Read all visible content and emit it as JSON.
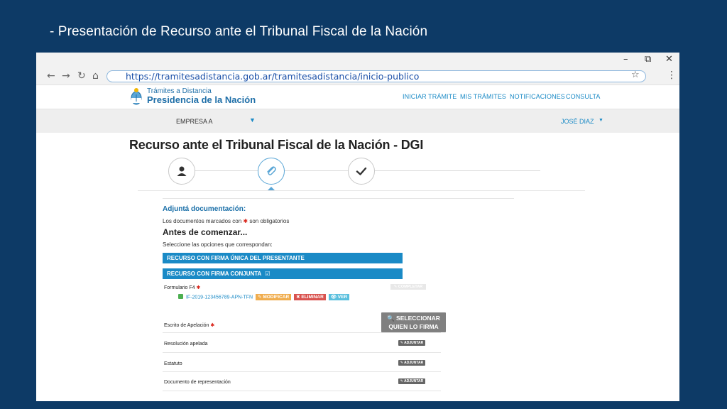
{
  "slide": {
    "title": "- Presentación de Recurso ante el Tribunal Fiscal de la Nación"
  },
  "window": {
    "minimize": "–",
    "restore": "⧉",
    "close": "✕"
  },
  "browser": {
    "back": "←",
    "forward": "→",
    "reload": "↻",
    "home": "⌂",
    "url": "https://tramitesadistancia.gob.ar/tramitesadistancia/inicio-publico",
    "star": "☆",
    "menu": "⋮"
  },
  "site": {
    "logo_line1": "Trámites a Distancia",
    "logo_line2": "Presidencia de la Nación",
    "nav": [
      "INICIAR TRÁMITE",
      "MIS TRÁMITES",
      "NOTIFICACIONES",
      "CONSULTA"
    ]
  },
  "userbar": {
    "empresa": "EMPRESA A",
    "empresa_caret": "▼",
    "user": "JOSÉ DIAZ",
    "user_caret": "▼"
  },
  "page": {
    "title": "Recurso ante el Tribunal Fiscal de la Nación - DGI"
  },
  "form": {
    "section_title": "Adjuntá documentación:",
    "note_before": "Los documentos marcados con",
    "req_mark": "✱",
    "note_after": "son obligatorios",
    "before_title": "Antes de comenzar...",
    "select_hint": "Seleccione las opciones que correspondan:",
    "option1": "RECURSO CON FIRMA ÚNICA DEL PRESENTANTE",
    "option2": "RECURSO CON FIRMA CONJUNTA",
    "option2_check": "☑",
    "formulario_label": "Formulario F4",
    "completar": "✎ COMPLETAR",
    "file_name": "IF-2019-123456789-APN-TFN",
    "modificar": "✎ MODIFICAR",
    "eliminar": "✖ ELIMINAR",
    "ver": "👁 VER",
    "escrito_label": "Escrito de Apelación",
    "select_btn_line1": "🔍 SELECCIONAR",
    "select_btn_line2": "QUIEN LO FIRMA",
    "resolucion_label": "Resolución apelada",
    "estatuto_label": "Estatuto",
    "representacion_label": "Documento de representación",
    "adjuntar": "✎ ADJUNTAR"
  },
  "colors": {
    "slide_bg": "#0d3a66",
    "accent": "#1a8ac6",
    "req": "#d9261c"
  }
}
